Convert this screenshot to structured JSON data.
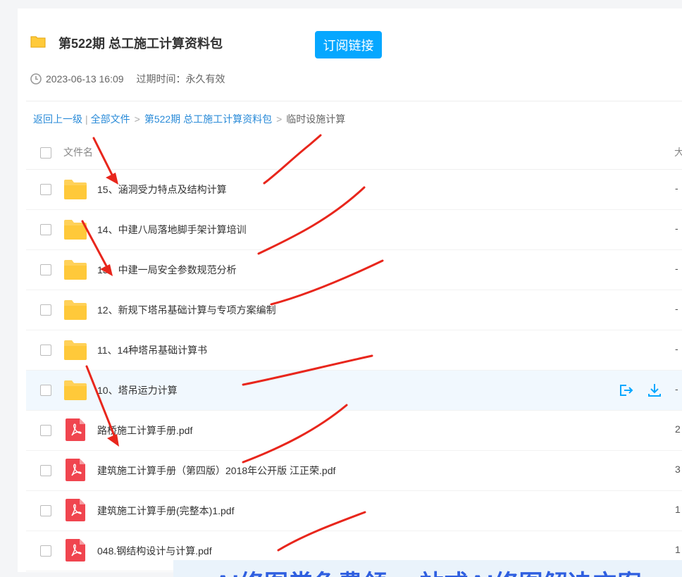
{
  "header": {
    "title": "第522期 总工施工计算资料包",
    "subscribe_label": "订阅链接",
    "date": "2023-06-13 16:09",
    "expiry": "过期时间：永久有效"
  },
  "breadcrumb": {
    "back": "返回上一级",
    "all": "全部文件",
    "parent": "第522期 总工施工计算资料包",
    "current": "临时设施计算"
  },
  "table": {
    "col_name": "文件名",
    "col_size": "大"
  },
  "files": [
    {
      "name": "15、涵洞受力特点及结构计算",
      "size": "-",
      "type": "folder"
    },
    {
      "name": "14、中建八局落地脚手架计算培训",
      "size": "-",
      "type": "folder"
    },
    {
      "name": "13、中建一局安全参数规范分析",
      "size": "-",
      "type": "folder"
    },
    {
      "name": "12、新规下塔吊基础计算与专项方案编制",
      "size": "-",
      "type": "folder"
    },
    {
      "name": "11、14种塔吊基础计算书",
      "size": "-",
      "type": "folder"
    },
    {
      "name": "10、塔吊运力计算",
      "size": "-",
      "type": "folder"
    },
    {
      "name": "路桥施工计算手册.pdf",
      "size": "2",
      "type": "pdf"
    },
    {
      "name": "建筑施工计算手册（第四版）2018年公开版 江正荣.pdf",
      "size": "3",
      "type": "pdf"
    },
    {
      "name": "建筑施工计算手册(完整本)1.pdf",
      "size": "1",
      "type": "pdf"
    },
    {
      "name": "048.钢结构设计与计算.pdf",
      "size": "1",
      "type": "pdf"
    }
  ],
  "banner": {
    "text": "AI修图常免费领 一站式AI修图解决方案"
  },
  "colors": {
    "accent": "#06a7ff",
    "link": "#2a8bd8",
    "folder": "#ffd159",
    "pdf": "#f0454f",
    "annotation": "#e8261c"
  }
}
